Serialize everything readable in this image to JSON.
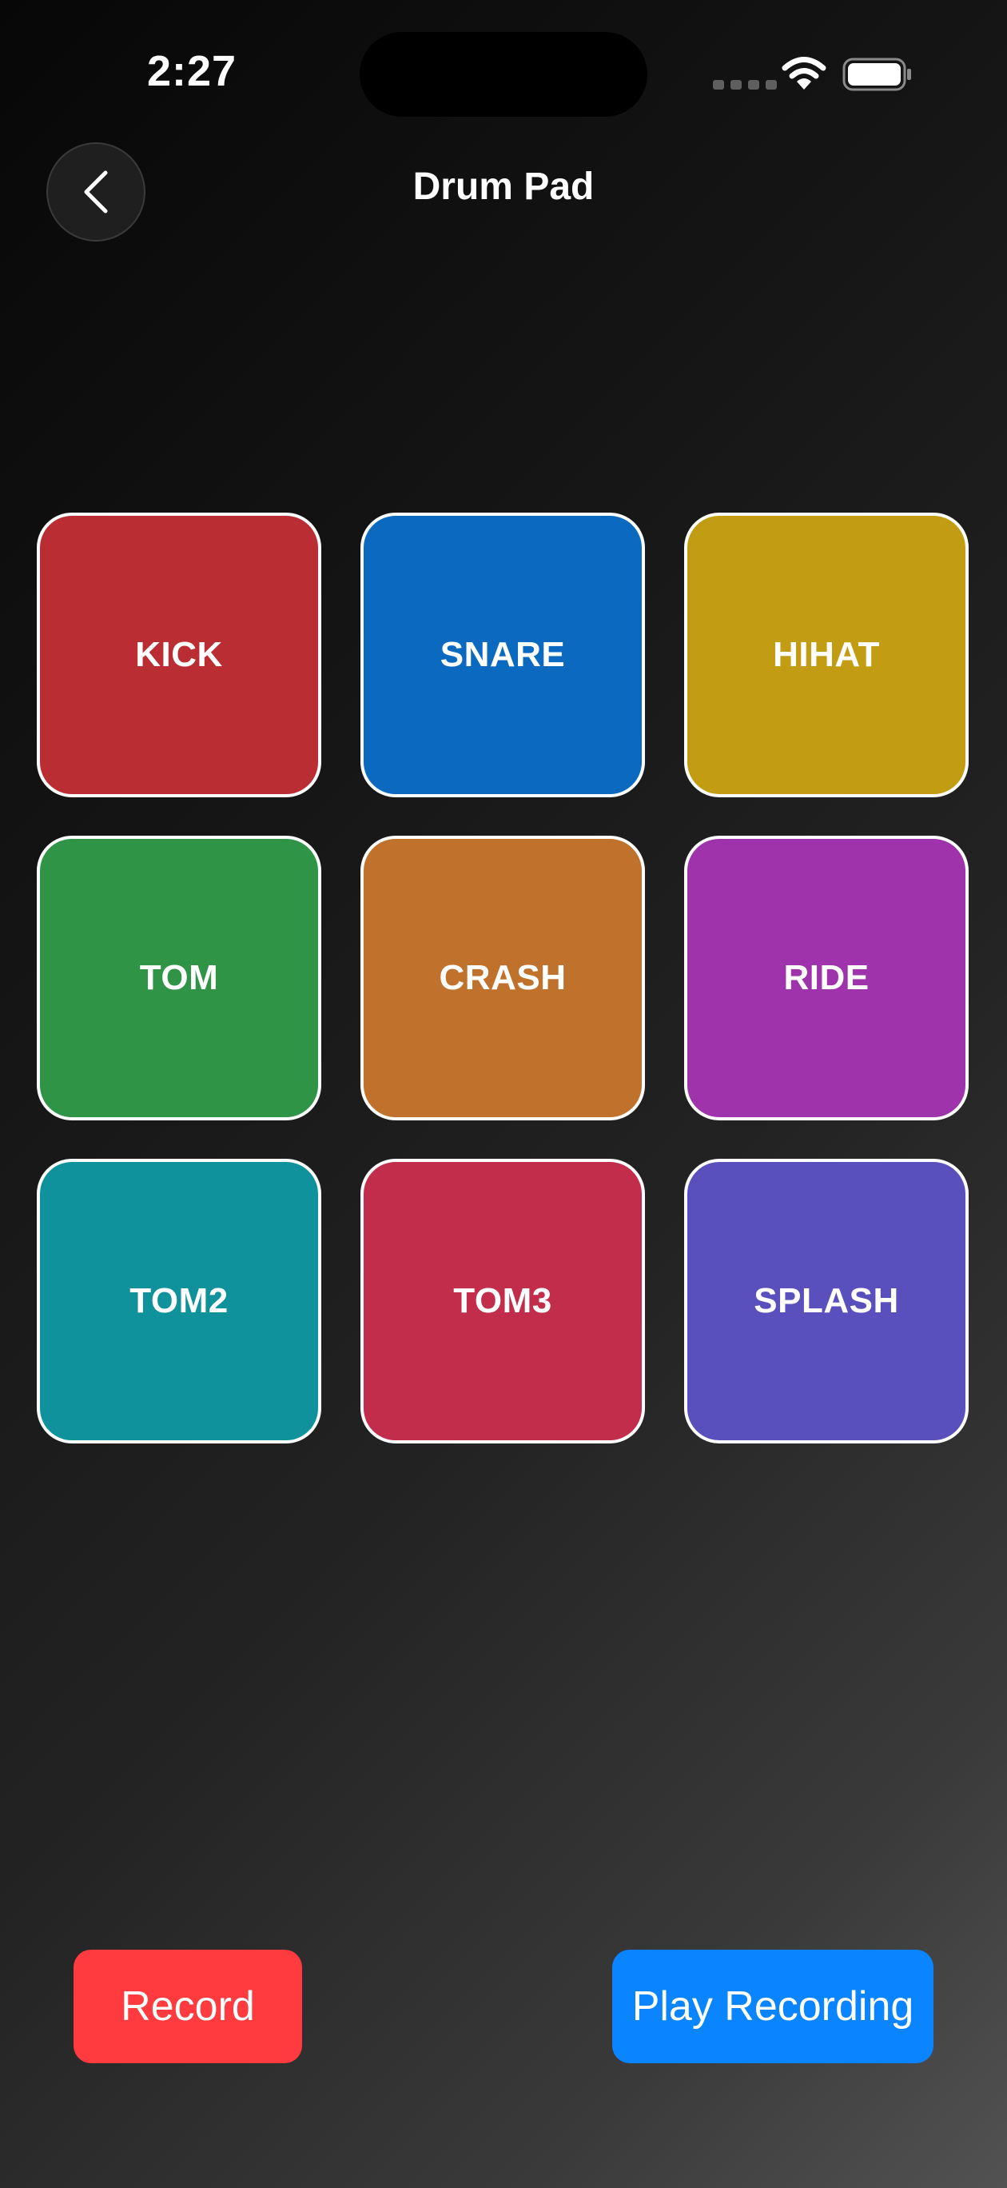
{
  "status_bar": {
    "time": "2:27",
    "icons": [
      "cellular-signal-icon",
      "wifi-icon",
      "battery-icon"
    ]
  },
  "nav": {
    "back_icon": "chevron-left-icon",
    "title": "Drum Pad"
  },
  "pads": [
    {
      "label": "KICK",
      "color": "#b92d33"
    },
    {
      "label": "SNARE",
      "color": "#0b69c0"
    },
    {
      "label": "HIHAT",
      "color": "#c29d14"
    },
    {
      "label": "TOM",
      "color": "#2f9446"
    },
    {
      "label": "CRASH",
      "color": "#c0712b"
    },
    {
      "label": "RIDE",
      "color": "#9e33ab"
    },
    {
      "label": "TOM2",
      "color": "#0f929c"
    },
    {
      "label": "TOM3",
      "color": "#c22d4b"
    },
    {
      "label": "SPLASH",
      "color": "#5a50bd"
    }
  ],
  "controls": {
    "record_label": "Record",
    "record_color": "#ff3b3f",
    "play_label": "Play Recording",
    "play_color": "#0a84ff"
  }
}
